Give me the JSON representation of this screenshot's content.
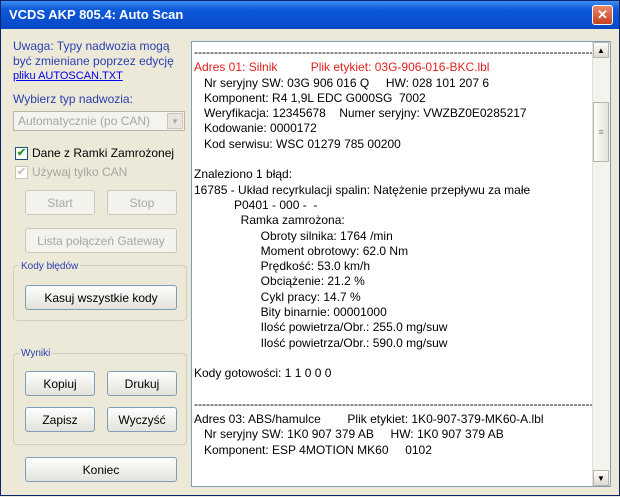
{
  "window": {
    "title": "VCDS AKP 805.4:  Auto Scan",
    "close_label": "✕"
  },
  "sidebar": {
    "warning": "Uwaga:  Typy nadwozia mogą być zmieniane poprzez edycję",
    "link": "pliku AUTOSCAN.TXT",
    "body_type_label": "Wybierz typ nadwozia:",
    "body_type_value": "Automatycznie (po CAN)",
    "checkbox_freeze": "Dane z Ramki Zamrożonej",
    "checkbox_can": "Używaj tylko CAN",
    "start": "Start",
    "stop": "Stop",
    "gateway": "Lista połączeń Gateway",
    "codes_group": "Kody błędów",
    "clear_codes": "Kasuj wszystkie kody",
    "results_group": "Wyniki",
    "copy": "Kopiuj",
    "print": "Drukuj",
    "save": "Zapisz",
    "clear": "Wyczyść",
    "exit": "Koniec"
  },
  "output": {
    "lines": [
      {
        "text": "-----------------------------------------------------------------------------------------------------",
        "red": false
      },
      {
        "text": "Adres 01: Silnik          Plik etykiet: 03G-906-016-BKC.lbl",
        "red": true
      },
      {
        "text": "   Nr seryjny SW: 03G 906 016 Q     HW: 028 101 207 6",
        "red": false
      },
      {
        "text": "   Komponent: R4 1,9L EDC G000SG  7002",
        "red": false
      },
      {
        "text": "   Weryfikacja: 12345678    Numer seryjny: VWZBZ0E0285217",
        "red": false
      },
      {
        "text": "   Kodowanie: 0000172",
        "red": false
      },
      {
        "text": "   Kod serwisu: WSC 01279 785 00200",
        "red": false
      },
      {
        "text": "",
        "red": false
      },
      {
        "text": "Znaleziono 1 błąd:",
        "red": false
      },
      {
        "text": "16785 - Układ recyrkulacji spalin: Natężenie przepływu za małe",
        "red": false
      },
      {
        "text": "            P0401 - 000 -  -",
        "red": false
      },
      {
        "text": "              Ramka zamrożona:",
        "red": false
      },
      {
        "text": "                    Obroty silnika: 1764 /min",
        "red": false
      },
      {
        "text": "                    Moment obrotowy: 62.0 Nm",
        "red": false
      },
      {
        "text": "                    Prędkość: 53.0 km/h",
        "red": false
      },
      {
        "text": "                    Obciążenie: 21.2 %",
        "red": false
      },
      {
        "text": "                    Cykl pracy: 14.7 %",
        "red": false
      },
      {
        "text": "                    Bity binarnie: 00001000",
        "red": false
      },
      {
        "text": "                    Ilość powietrza/Obr.: 255.0 mg/suw",
        "red": false
      },
      {
        "text": "                    Ilość powietrza/Obr.: 590.0 mg/suw",
        "red": false
      },
      {
        "text": "",
        "red": false
      },
      {
        "text": "Kody gotowości: 1 1 0 0 0",
        "red": false
      },
      {
        "text": "",
        "red": false
      },
      {
        "text": "-----------------------------------------------------------------------------------------------------",
        "red": false
      },
      {
        "text": "Adres 03: ABS/hamulce        Plik etykiet: 1K0-907-379-MK60-A.lbl",
        "red": false
      },
      {
        "text": "   Nr seryjny SW: 1K0 907 379 AB     HW: 1K0 907 379 AB",
        "red": false
      },
      {
        "text": "   Komponent: ESP 4MOTION MK60     0102",
        "red": false
      }
    ]
  },
  "scrollbar": {
    "up_icon": "▲",
    "down_icon": "▼",
    "thumb_icon": "≡"
  }
}
